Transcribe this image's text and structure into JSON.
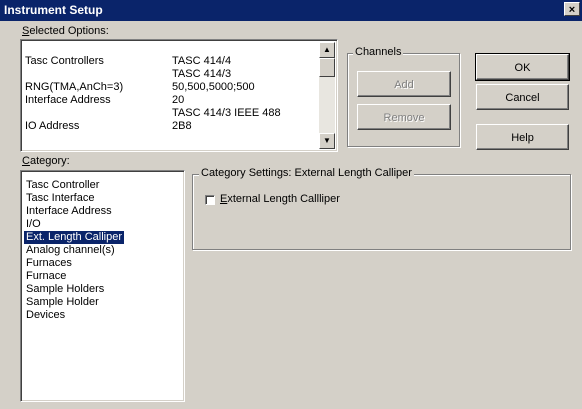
{
  "window": {
    "title": "Instrument Setup",
    "close_glyph": "×"
  },
  "selected_options": {
    "label_prefix": "S",
    "label_rest": "elected Options:",
    "rows": [
      {
        "key": "Tasc Controllers",
        "value": "TASC 414/4"
      },
      {
        "key": "",
        "value": "TASC 414/3"
      },
      {
        "key": "RNG(TMA,AnCh=3)",
        "value": "50,500,5000;500"
      },
      {
        "key": "Interface Address",
        "value": "20"
      },
      {
        "key": "",
        "value": "TASC 414/3  IEEE 488"
      },
      {
        "key": "IO Address",
        "value": "2B8"
      }
    ],
    "scroll_up_icon": "▲",
    "scroll_down_icon": "▼"
  },
  "channels": {
    "legend": "Channels",
    "add_label": "Add",
    "remove_label": "Remove"
  },
  "buttons": {
    "ok_label": "OK",
    "cancel_label": "Cancel",
    "help_label": "Help"
  },
  "category": {
    "label_prefix": "C",
    "label_rest": "ategory:",
    "items": [
      "Tasc Controller",
      "Tasc Interface",
      "Interface Address",
      "I/O",
      "Ext. Length Calliper",
      "Analog channel(s)",
      "Furnaces",
      "Furnace",
      "Sample Holders",
      "Sample Holder",
      "Devices"
    ],
    "selected_index": 4
  },
  "category_settings": {
    "legend": "Category Settings: External Length Calliper",
    "checkbox_label_prefix": "E",
    "checkbox_label_rest": "xternal Length Callliper",
    "checked": false
  },
  "colors": {
    "face": "#d4d0c8",
    "titlebar": "#0a246a",
    "selection": "#0a246a"
  }
}
